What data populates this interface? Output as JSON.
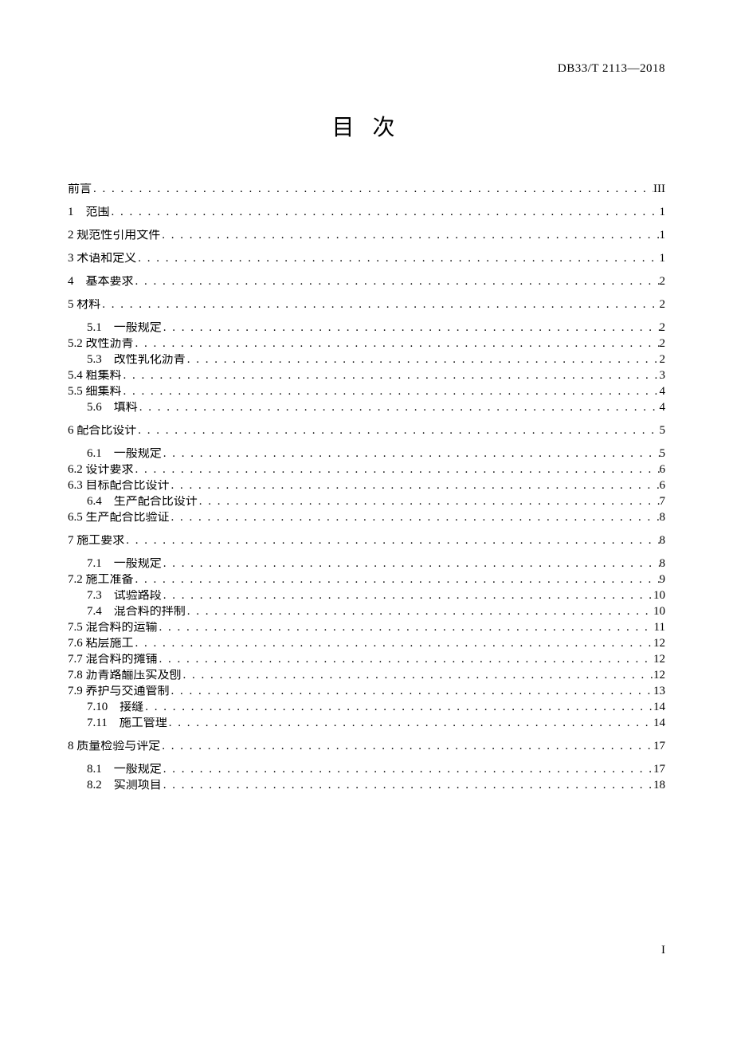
{
  "doc_id": "DB33/T 2113—2018",
  "title": "目 次",
  "page_number": "I",
  "toc_groups": [
    [
      {
        "level": 0,
        "label": "前言",
        "page": "III"
      }
    ],
    [
      {
        "level": 0,
        "label": "1　范围",
        "page": "1"
      }
    ],
    [
      {
        "level": 0,
        "label": "2 规范性引用文件",
        "page": "1"
      }
    ],
    [
      {
        "level": 0,
        "label": "3 术语和定义",
        "page": "1"
      }
    ],
    [
      {
        "level": 0,
        "label": "4　基本要求",
        "page": "2"
      }
    ],
    [
      {
        "level": 0,
        "label": "5 材料",
        "page": "2"
      }
    ],
    [
      {
        "level": 1,
        "label": "5.1　一般规定",
        "page": "2"
      },
      {
        "level": 0,
        "label": "5.2 改性沥青",
        "page": "2"
      },
      {
        "level": 1,
        "label": "5.3　改性乳化沥青",
        "page": "2"
      },
      {
        "level": 0,
        "label": "5.4 粗集料",
        "page": "3"
      },
      {
        "level": 0,
        "label": "5.5 细集料",
        "page": "4"
      },
      {
        "level": 1,
        "label": "5.6　填料",
        "page": "4"
      }
    ],
    [
      {
        "level": 0,
        "label": "6 配合比设计",
        "page": "5"
      }
    ],
    [
      {
        "level": 1,
        "label": "6.1　一般规定",
        "page": "5"
      },
      {
        "level": 0,
        "label": "6.2 设计要求",
        "page": "6"
      },
      {
        "level": 0,
        "label": "6.3 目标配合比设计",
        "page": "6"
      },
      {
        "level": 1,
        "label": "6.4　生产配合比设计",
        "page": "7"
      },
      {
        "level": 0,
        "label": "6.5 生产配合比验证",
        "page": "8"
      }
    ],
    [
      {
        "level": 0,
        "label": "7 施工要求",
        "page": "8"
      }
    ],
    [
      {
        "level": 1,
        "label": "7.1　一般规定",
        "page": "8"
      },
      {
        "level": 0,
        "label": "7.2 施工准备",
        "page": "9"
      },
      {
        "level": 1,
        "label": "7.3　试验路段",
        "page": "10"
      },
      {
        "level": 1,
        "label": "7.4　混合料的拌制",
        "page": "10"
      },
      {
        "level": 0,
        "label": "7.5 混合料的运输",
        "page": "11"
      },
      {
        "level": 0,
        "label": "7.6 粘层施工",
        "page": "12"
      },
      {
        "level": 0,
        "label": "7.7 混合料的摊铺",
        "page": "12"
      },
      {
        "level": 0,
        "label": "7.8 沥青路酾压实及刨",
        "page": "12"
      },
      {
        "level": 0,
        "label": "7.9 养护与交通管制",
        "page": "13"
      },
      {
        "level": 1,
        "label": "7.10　接缝",
        "page": "14"
      },
      {
        "level": 1,
        "label": "7.11　施工管理",
        "page": "14"
      }
    ],
    [
      {
        "level": 0,
        "label": "8 质量检验与评定",
        "page": "17"
      }
    ],
    [
      {
        "level": 1,
        "label": "8.1　一般规定",
        "page": "17"
      },
      {
        "level": 1,
        "label": "8.2　实测项目",
        "page": "18"
      }
    ]
  ]
}
